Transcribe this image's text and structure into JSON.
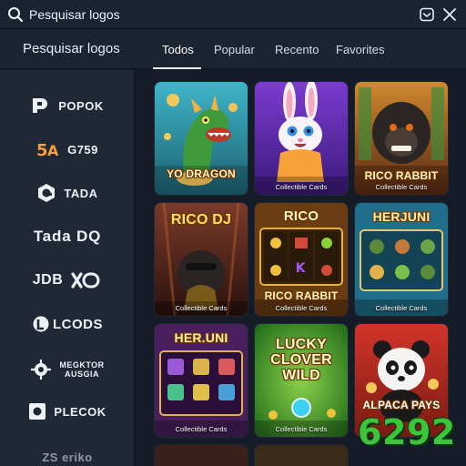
{
  "search": {
    "placeholder": "Pesquisar logos",
    "value": ""
  },
  "header": {
    "title": "Pesquisar logos",
    "tabs": [
      {
        "label": "Todos",
        "active": true
      },
      {
        "label": "Popular",
        "active": false
      },
      {
        "label": "Recento",
        "active": false
      },
      {
        "label": "Favorites",
        "active": false
      }
    ]
  },
  "sidebar": {
    "brands": [
      {
        "name": "POPOK",
        "icon": "popok-logo-icon"
      },
      {
        "name": "G759",
        "icon": "ga-logo-icon"
      },
      {
        "name": "TADA",
        "icon": "tada-logo-icon"
      },
      {
        "name": "Tada DQ",
        "icon": ""
      },
      {
        "name": "JDB",
        "icon": "xo-logo-icon"
      },
      {
        "name": "LCODS",
        "icon": "lcods-logo-icon"
      },
      {
        "name": "MEGKTOR AUSGIA",
        "icon": "megktor-logo-icon"
      },
      {
        "name": "PLECOK",
        "icon": "plecok-logo-icon"
      },
      {
        "name": "ZS eriko",
        "icon": "zs-logo-icon"
      }
    ]
  },
  "games": [
    {
      "title": "YO DRAGON",
      "caption": ""
    },
    {
      "title": "",
      "caption": "Collectible Cards"
    },
    {
      "title": "RICO RABBIT",
      "caption": "Collectible Cards"
    },
    {
      "title": "RICO DJ",
      "caption": "Collectible Cards"
    },
    {
      "title": "RICO RABBIT",
      "caption": "Collectible Cards",
      "top_title": "RICO"
    },
    {
      "title": "HERJUNI",
      "caption": "Collectible Cards"
    },
    {
      "title": "HER.UNI",
      "caption": "Collectible Cards"
    },
    {
      "title": "LUCKY CLOVER WILD",
      "caption": "Collectible Cards"
    },
    {
      "title": "ALPACA PAYS",
      "caption": ""
    }
  ],
  "watermark": "6292",
  "colors": {
    "background": "#111823",
    "sidebar": "#1f2834",
    "header": "#1b2431",
    "watermark": "#3cc43a"
  }
}
